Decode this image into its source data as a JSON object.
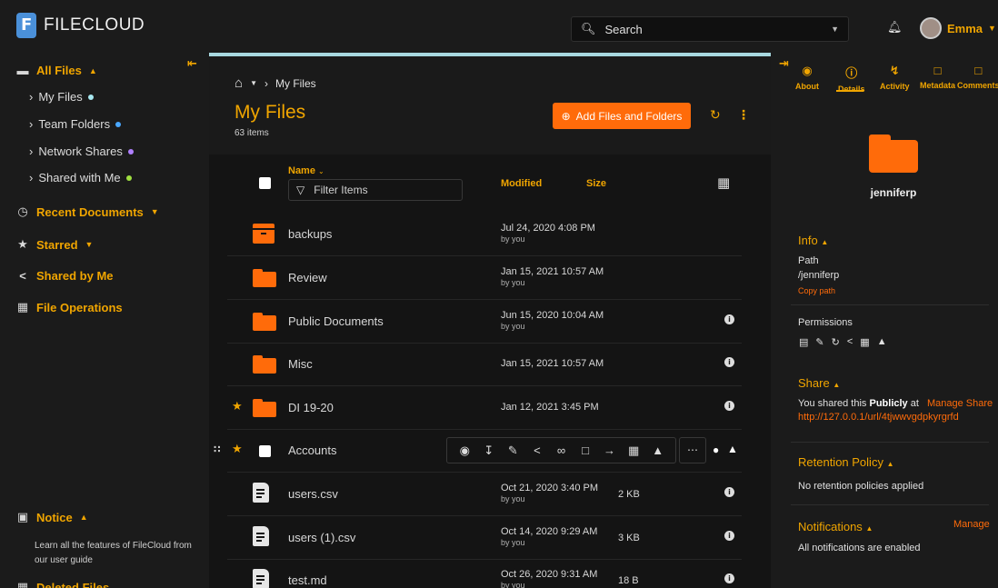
{
  "app": {
    "name": "FILECLOUD"
  },
  "search": {
    "placeholder": "Search"
  },
  "user": {
    "name": "Emma"
  },
  "sidebar": {
    "all_files": "All Files",
    "my_files": "My Files",
    "team_folders": "Team Folders",
    "network_shares": "Network Shares",
    "shared_with_me": "Shared with Me",
    "recent_documents": "Recent Documents",
    "starred": "Starred",
    "shared_by_me": "Shared by Me",
    "file_operations": "File Operations",
    "notice": "Notice",
    "notice_text": "Learn all the features of FileCloud from our user guide",
    "deleted_files": "Deleted Files",
    "dot_colors": {
      "my_files": "#a8e8f0",
      "team_folders": "#4aa8ff",
      "network_shares": "#b080ff",
      "shared_with_me": "#a0e040"
    }
  },
  "breadcrumb": {
    "current": "My Files"
  },
  "main": {
    "title": "My Files",
    "count": "63 items",
    "add_button": "Add Files and Folders",
    "columns": {
      "name": "Name",
      "modified": "Modified",
      "size": "Size"
    },
    "filter_placeholder": "Filter Items"
  },
  "files": [
    {
      "name": "backups",
      "modified": "Jul 24, 2020 4:08 PM",
      "by": "by you",
      "size": ""
    },
    {
      "name": "Review",
      "modified": "Jan 15, 2021 10:57 AM",
      "by": "by you",
      "size": ""
    },
    {
      "name": "Public Documents",
      "modified": "Jun 15, 2020 10:04 AM",
      "by": "by you",
      "size": ""
    },
    {
      "name": "Misc",
      "modified": "Jan 15, 2021 10:57 AM",
      "by": "",
      "size": ""
    },
    {
      "name": "DI 19-20",
      "modified": "Jan 12, 2021 3:45 PM",
      "by": "",
      "size": ""
    },
    {
      "name": "Accounts",
      "modified": "",
      "by": "",
      "size": ""
    },
    {
      "name": "users.csv",
      "modified": "Oct 21, 2020 3:40 PM",
      "by": "by you",
      "size": "2 KB"
    },
    {
      "name": "users (1).csv",
      "modified": "Oct 14, 2020 9:29 AM",
      "by": "by you",
      "size": "3 KB"
    },
    {
      "name": "test.md",
      "modified": "Oct 26, 2020 9:31 AM",
      "by": "by you",
      "size": "18 B"
    }
  ],
  "rpanel": {
    "tabs": [
      "About",
      "Details",
      "Activity",
      "Metadata",
      "Comments"
    ],
    "owner": "jenniferp",
    "info_title": "Info",
    "path_label": "Path",
    "path_value": "/jenniferp",
    "copy_path": "Copy path",
    "permissions_label": "Permissions",
    "share_title": "Share",
    "share_prefix": "You shared this",
    "share_bold": "Publicly",
    "share_at": "at",
    "manage_share": "Manage Share",
    "share_url": "http://127.0.0.1/url/4tjwwvgdpkyrgrfd",
    "retention_title": "Retention Policy",
    "retention_text": "No retention policies applied",
    "notifications_title": "Notifications",
    "notifications_text": "All notifications are enabled",
    "manage": "Manage"
  },
  "colors": {
    "accent": "#f0a500",
    "brand_orange": "#ff6b0a",
    "progress_line": "#a8d8e0"
  }
}
